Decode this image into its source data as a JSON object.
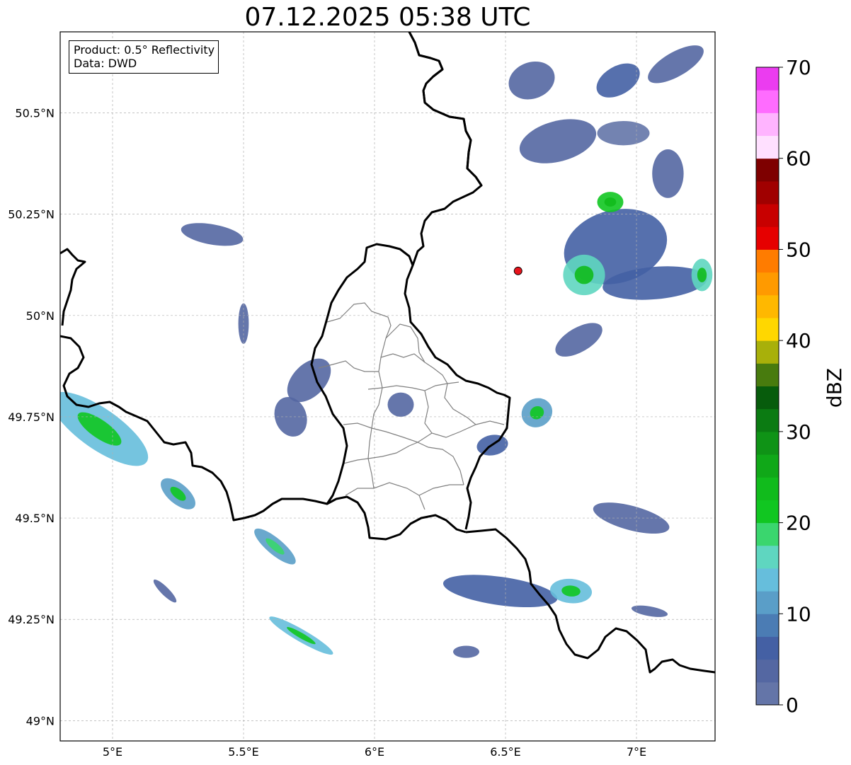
{
  "title": "07.12.2025 05:38 UTC",
  "info_box": {
    "product": "Product: 0.5° Reflectivity",
    "data_source": "Data: DWD"
  },
  "map": {
    "lon_range": [
      4.8,
      7.3
    ],
    "lat_range": [
      48.95,
      50.7
    ],
    "lat_ticks": [
      {
        "value": 50.5,
        "label": "50.5°N"
      },
      {
        "value": 50.25,
        "label": "50.25°N"
      },
      {
        "value": 50.0,
        "label": "50°N"
      },
      {
        "value": 49.75,
        "label": "49.75°N"
      },
      {
        "value": 49.5,
        "label": "49.5°N"
      },
      {
        "value": 49.25,
        "label": "49.25°N"
      },
      {
        "value": 49.0,
        "label": "49°N"
      }
    ],
    "lon_ticks": [
      {
        "value": 5.0,
        "label": "5°E"
      },
      {
        "value": 5.5,
        "label": "5.5°E"
      },
      {
        "value": 6.0,
        "label": "6°E"
      },
      {
        "value": 6.5,
        "label": "6.5°E"
      },
      {
        "value": 7.0,
        "label": "7°E"
      }
    ],
    "radar_site": {
      "lon": 6.548,
      "lat": 50.11,
      "color": "#e8141c"
    },
    "colors": {
      "grid": "#b0b0b0",
      "border": "#000000",
      "canton": "#808080"
    }
  },
  "colorbar": {
    "label": "dBZ",
    "vmin": 0,
    "vmax": 70,
    "ticks": [
      0,
      10,
      20,
      30,
      40,
      50,
      60,
      70
    ],
    "colors": [
      "#6475a8",
      "#5467a2",
      "#4460a4",
      "#4b7cb4",
      "#5a9ec8",
      "#66bedc",
      "#5fd6c0",
      "#3ad66e",
      "#11c621",
      "#11bb1c",
      "#10a818",
      "#0f9316",
      "#0b7b12",
      "#075c0c",
      "#487b0e",
      "#a8b00a",
      "#ffd700",
      "#ffb800",
      "#ff9a00",
      "#ff7c00",
      "#e60000",
      "#c80000",
      "#a00000",
      "#7e0000",
      "#ffe0ff",
      "#ffb4ff",
      "#ff6cff",
      "#eb3cf0"
    ]
  },
  "echoes": [
    {
      "lon": 6.6,
      "lat": 50.58,
      "rx": 0.09,
      "ry": 0.045,
      "rot": -20,
      "dbz": 3
    },
    {
      "lon": 6.93,
      "lat": 50.58,
      "rx": 0.09,
      "ry": 0.035,
      "rot": -30,
      "dbz": 5
    },
    {
      "lon": 7.15,
      "lat": 50.62,
      "rx": 0.12,
      "ry": 0.03,
      "rot": -30,
      "dbz": 4
    },
    {
      "lon": 6.7,
      "lat": 50.43,
      "rx": 0.15,
      "ry": 0.05,
      "rot": -15,
      "dbz": 3
    },
    {
      "lon": 6.95,
      "lat": 50.45,
      "rx": 0.1,
      "ry": 0.03,
      "rot": 0,
      "dbz": 2
    },
    {
      "lon": 7.12,
      "lat": 50.35,
      "rx": 0.06,
      "ry": 0.06,
      "rot": 0,
      "dbz": 4
    },
    {
      "lon": 6.92,
      "lat": 50.17,
      "rx": 0.2,
      "ry": 0.09,
      "rot": -15,
      "dbz": 7
    },
    {
      "lon": 6.8,
      "lat": 50.1,
      "rx": 0.08,
      "ry": 0.05,
      "rot": 0,
      "dbz": 16
    },
    {
      "lon": 7.07,
      "lat": 50.08,
      "rx": 0.2,
      "ry": 0.04,
      "rot": -5,
      "dbz": 5
    },
    {
      "lon": 7.25,
      "lat": 50.1,
      "rx": 0.04,
      "ry": 0.04,
      "rot": 0,
      "dbz": 15
    },
    {
      "lon": 6.9,
      "lat": 50.28,
      "rx": 0.05,
      "ry": 0.025,
      "rot": 0,
      "dbz": 22
    },
    {
      "lon": 6.78,
      "lat": 49.94,
      "rx": 0.1,
      "ry": 0.03,
      "rot": -30,
      "dbz": 4
    },
    {
      "lon": 5.38,
      "lat": 50.2,
      "rx": 0.12,
      "ry": 0.025,
      "rot": 10,
      "dbz": 4
    },
    {
      "lon": 5.75,
      "lat": 49.84,
      "rx": 0.1,
      "ry": 0.04,
      "rot": -45,
      "dbz": 3
    },
    {
      "lon": 5.68,
      "lat": 49.75,
      "rx": 0.06,
      "ry": 0.05,
      "rot": -20,
      "dbz": 3
    },
    {
      "lon": 6.1,
      "lat": 49.78,
      "rx": 0.05,
      "ry": 0.03,
      "rot": 0,
      "dbz": 4
    },
    {
      "lon": 6.45,
      "lat": 49.68,
      "rx": 0.06,
      "ry": 0.025,
      "rot": -10,
      "dbz": 5
    },
    {
      "lon": 6.62,
      "lat": 49.76,
      "rx": 0.06,
      "ry": 0.035,
      "rot": -30,
      "dbz": 12
    },
    {
      "lon": 6.98,
      "lat": 49.5,
      "rx": 0.15,
      "ry": 0.03,
      "rot": 15,
      "dbz": 3
    },
    {
      "lon": 6.48,
      "lat": 49.32,
      "rx": 0.22,
      "ry": 0.035,
      "rot": 8,
      "dbz": 6
    },
    {
      "lon": 6.75,
      "lat": 49.32,
      "rx": 0.08,
      "ry": 0.03,
      "rot": 5,
      "dbz": 13
    },
    {
      "lon": 4.95,
      "lat": 49.72,
      "rx": 0.22,
      "ry": 0.05,
      "rot": 35,
      "dbz": 13
    },
    {
      "lon": 5.25,
      "lat": 49.56,
      "rx": 0.08,
      "ry": 0.025,
      "rot": 40,
      "dbz": 12
    },
    {
      "lon": 5.62,
      "lat": 49.43,
      "rx": 0.1,
      "ry": 0.02,
      "rot": 40,
      "dbz": 11
    },
    {
      "lon": 5.72,
      "lat": 49.21,
      "rx": 0.14,
      "ry": 0.015,
      "rot": 30,
      "dbz": 14
    },
    {
      "lon": 5.2,
      "lat": 49.32,
      "rx": 0.06,
      "ry": 0.01,
      "rot": 45,
      "dbz": 3
    },
    {
      "lon": 5.5,
      "lat": 49.98,
      "rx": 0.02,
      "ry": 0.05,
      "rot": 0,
      "dbz": 4
    },
    {
      "lon": 6.35,
      "lat": 49.17,
      "rx": 0.05,
      "ry": 0.015,
      "rot": 0,
      "dbz": 4
    },
    {
      "lon": 7.05,
      "lat": 49.27,
      "rx": 0.07,
      "ry": 0.012,
      "rot": 10,
      "dbz": 4
    }
  ]
}
